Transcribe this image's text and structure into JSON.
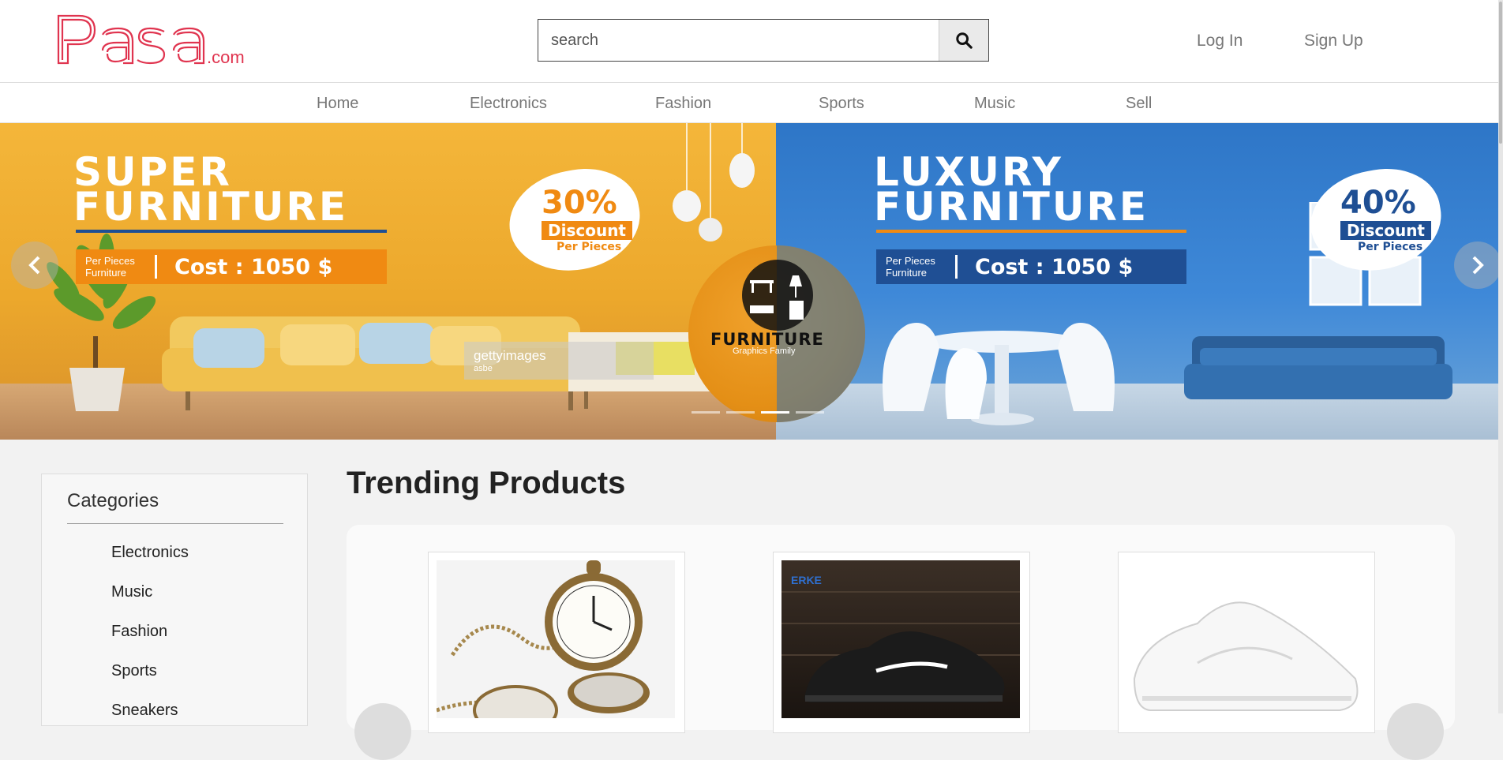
{
  "header": {
    "logo_text": "Pasa",
    "logo_suffix": ".com",
    "search": {
      "placeholder": "search",
      "value": ""
    },
    "login_label": "Log In",
    "signup_label": "Sign Up"
  },
  "nav": {
    "items": [
      {
        "label": "Home"
      },
      {
        "label": "Electronics"
      },
      {
        "label": "Fashion"
      },
      {
        "label": "Sports"
      },
      {
        "label": "Music"
      },
      {
        "label": "Sell"
      }
    ]
  },
  "banner": {
    "left": {
      "title_line1": "SUPER",
      "title_line2": "FURNITURE",
      "cost_small_line1": "Per Pieces",
      "cost_small_line2": "Furniture",
      "cost": "Cost : 1050 $",
      "discount_pct": "30%",
      "discount_label": "Discount",
      "discount_per": "Per Pieces"
    },
    "right": {
      "title_line1": "LUXURY",
      "title_line2": "FURNITURE",
      "cost_small_line1": "Per Pieces",
      "cost_small_line2": "Furniture",
      "cost": "Cost : 1050 $",
      "discount_pct": "40%",
      "discount_label": "Discount",
      "discount_per": "Per Pieces"
    },
    "center_badge": {
      "word": "FURNITURE",
      "sub": "Graphics Family"
    },
    "watermark": {
      "brand": "gettyimages",
      "credit": "asbe"
    },
    "active_slide": 3,
    "slide_count": 4,
    "colors": {
      "orange": "#f08a12",
      "blue": "#1f4f94"
    }
  },
  "categories": {
    "title": "Categories",
    "items": [
      {
        "label": "Electronics"
      },
      {
        "label": "Music"
      },
      {
        "label": "Fashion"
      },
      {
        "label": "Sports"
      },
      {
        "label": "Sneakers"
      }
    ]
  },
  "trending": {
    "title": "Trending Products",
    "products": [
      {
        "image": "pocket-watch"
      },
      {
        "image": "black-running-shoe",
        "brand": "ERKE"
      },
      {
        "image": "white-sneaker"
      }
    ]
  },
  "colors": {
    "brand": "#e0344f",
    "page_bg": "#f2f2f2"
  }
}
